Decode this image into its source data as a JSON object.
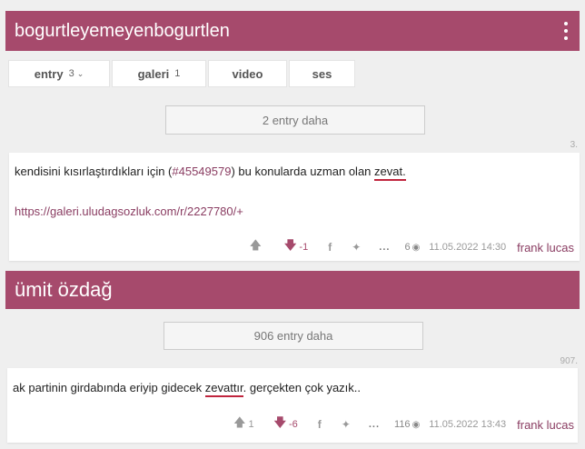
{
  "topic1": {
    "title": "bogurtleyemeyenbogurtlen",
    "tabs": [
      {
        "label": "entry",
        "count": "3"
      },
      {
        "label": "galeri",
        "count": "1"
      },
      {
        "label": "video",
        "count": ""
      },
      {
        "label": "ses",
        "count": ""
      }
    ],
    "more_label": "2 entry daha",
    "entry_no": "3.",
    "entry": {
      "text_before": "kendisini kısırlaştırdıkları için (",
      "ref_link": "#45549579",
      "text_mid": ") bu konularda uzman olan ",
      "highlight": "zevat",
      "text_after": ".",
      "url": "https://galeri.uludagsozluk.com/r/2227780/",
      "url_plus": "+",
      "upvotes": "",
      "downvotes": "-1",
      "views": "6",
      "date": "11.05.2022 14:30",
      "author": "frank lucas"
    }
  },
  "topic2": {
    "title": "ümit özdağ",
    "more_label": "906 entry daha",
    "entry_no": "907.",
    "entry": {
      "text_before": "ak partinin girdabında eriyip gidecek ",
      "highlight": "zevattır",
      "text_after": ". gerçekten çok yazık..",
      "upvotes": "1",
      "downvotes": "-6",
      "views": "116",
      "date": "11.05.2022 13:43",
      "author": "frank lucas"
    }
  },
  "icons": {
    "menu": "vertical-dots-icon",
    "upvote": "arrow-up-icon",
    "downvote": "arrow-down-icon",
    "facebook": "facebook-icon",
    "twitter": "twitter-icon",
    "more": "ellipsis-icon",
    "views": "eye-icon"
  },
  "colors": {
    "brand": "#a64a6c",
    "link": "#8a3d62",
    "underline": "#c0253e"
  }
}
